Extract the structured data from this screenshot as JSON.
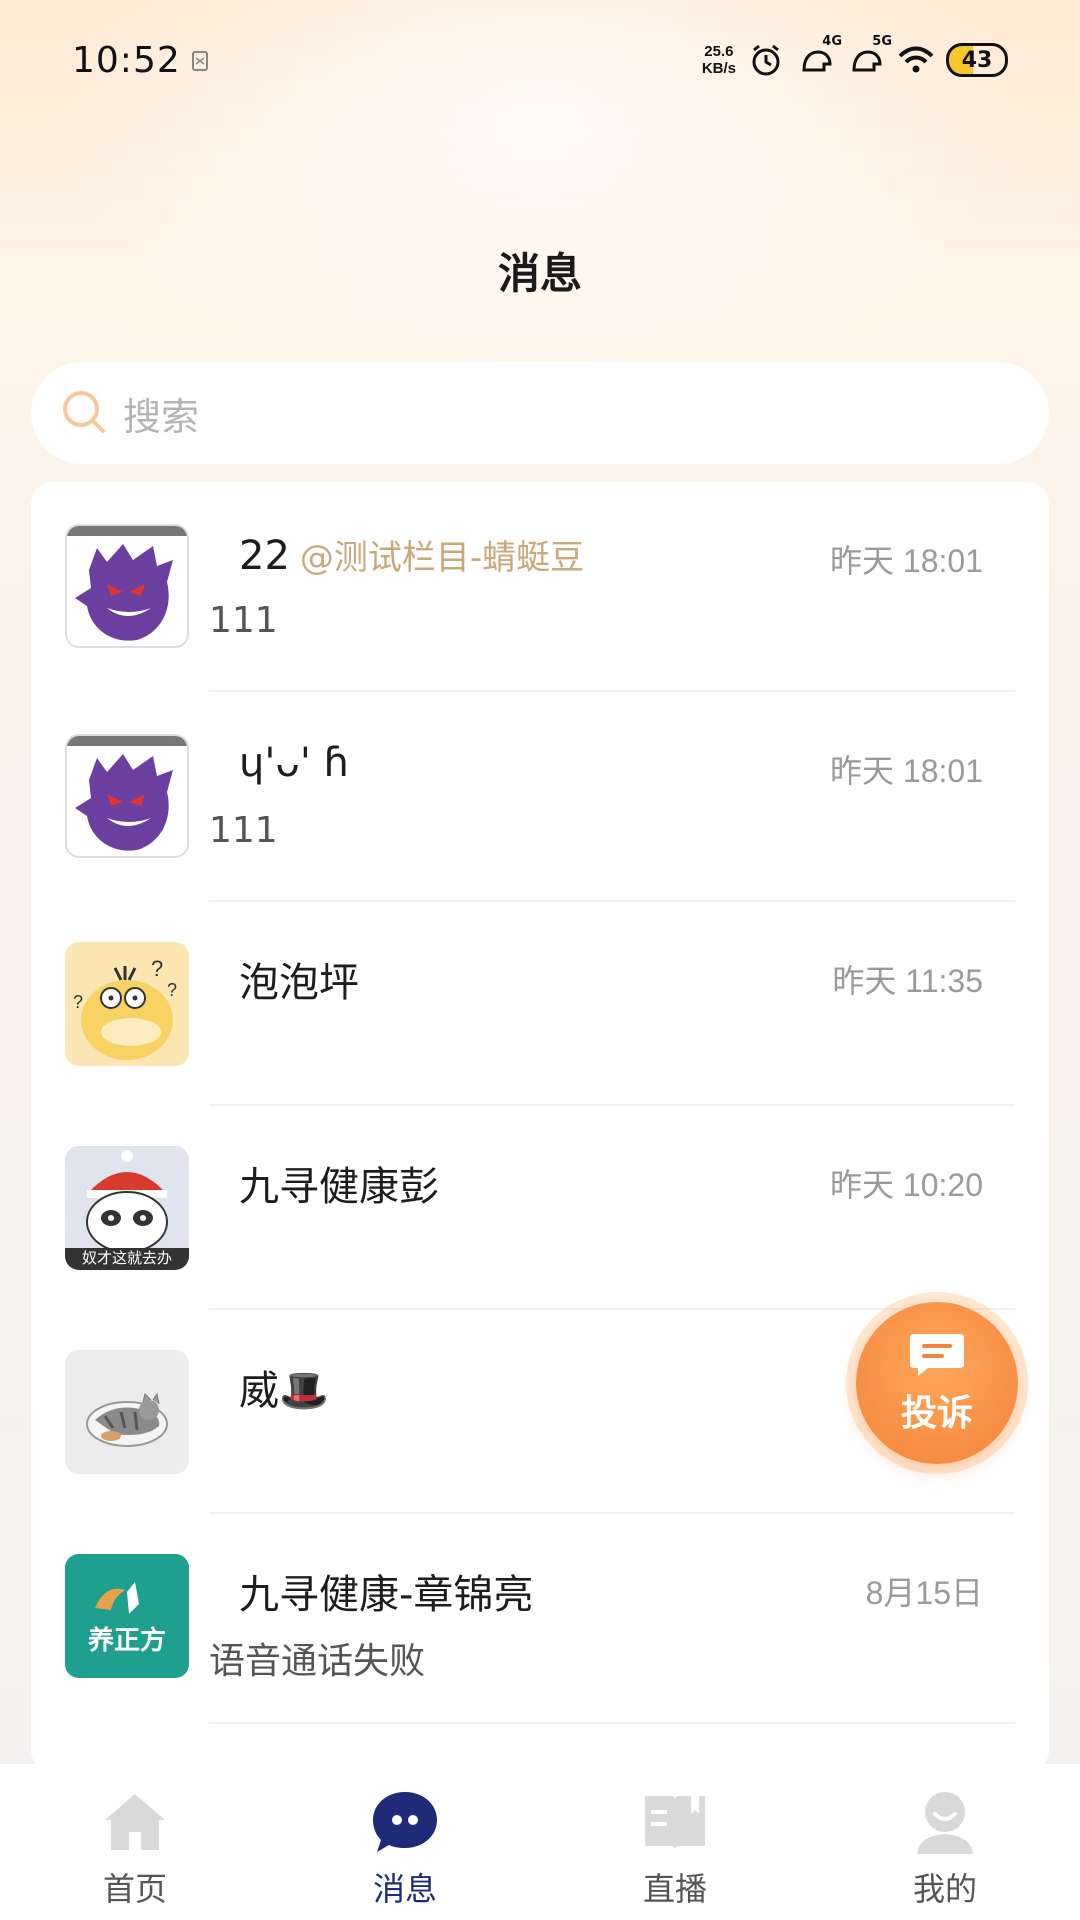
{
  "status_bar": {
    "time": "10:52",
    "net_speed_value": "25.6",
    "net_speed_unit": "KB/s",
    "signal_1_label": "4G",
    "signal_2_label": "5G",
    "battery": "43"
  },
  "header": {
    "title": "消息"
  },
  "search": {
    "placeholder": "搜索"
  },
  "conversations": [
    {
      "name": "22",
      "tag": "@测试栏目-蜻蜓豆",
      "time": "昨天 18:01",
      "preview": "111",
      "avatar": "gengar-avatar"
    },
    {
      "name": "ɥ'ᴗ' ɦ",
      "tag": "",
      "time": "昨天 18:01",
      "preview": "111",
      "avatar": "gengar-avatar"
    },
    {
      "name": "泡泡坪",
      "tag": "",
      "time": "昨天 11:35",
      "preview": "",
      "avatar": "psyduck-avatar"
    },
    {
      "name": "九寻健康彭",
      "tag": "",
      "time": "昨天 10:20",
      "preview": "",
      "avatar": "panda-meme-avatar",
      "avatar_caption": "奴才这就去办"
    },
    {
      "name": "威🎩",
      "tag": "",
      "time": "",
      "preview": "",
      "avatar": "cat-avatar"
    },
    {
      "name": "九寻健康-章锦亮",
      "tag": "",
      "time": "8月15日",
      "preview": "语音通话失败",
      "avatar": "brand-logo-avatar",
      "avatar_caption": "养正方"
    }
  ],
  "complaint_button": {
    "label": "投诉"
  },
  "bottom_nav": {
    "tabs": [
      {
        "label": "首页",
        "icon": "home-icon",
        "active": false
      },
      {
        "label": "消息",
        "icon": "chat-bubble-icon",
        "active": true
      },
      {
        "label": "直播",
        "icon": "book-icon",
        "active": false
      },
      {
        "label": "我的",
        "icon": "profile-icon",
        "active": false
      }
    ]
  },
  "colors": {
    "accent_orange": "#f4843a",
    "tag_gold": "#c9a97a",
    "active_nav": "#1f2a78",
    "inactive_icon": "#d9d9d9"
  }
}
